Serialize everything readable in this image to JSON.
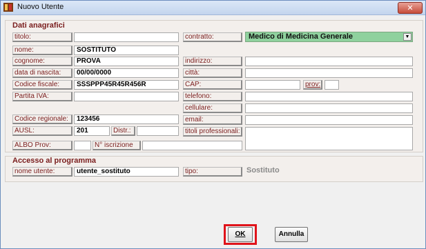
{
  "window": {
    "title": "Nuovo Utente",
    "close_label": "✕"
  },
  "anagrafica": {
    "title": "Dati anagrafici",
    "titolo": {
      "label": "titolo:",
      "value": ""
    },
    "nome": {
      "label": "nome:",
      "value": "SOSTITUTO"
    },
    "cognome": {
      "label": "cognome:",
      "value": "PROVA"
    },
    "data_nascita": {
      "label": "data di nascita:",
      "value": "00/00/0000"
    },
    "codice_fiscale": {
      "label": "Codice fiscale:",
      "value": "SSSPPP45R45R456R"
    },
    "partita_iva": {
      "label": "Partita IVA:",
      "value": ""
    },
    "codice_regionale": {
      "label": "Codice regionale:",
      "value": "123456"
    },
    "ausl": {
      "label": "AUSL:",
      "value": "201"
    },
    "distr": {
      "label": "Distr.:",
      "value": ""
    },
    "albo_prov": {
      "label": "ALBO Prov:",
      "value": ""
    },
    "n_iscrizione": {
      "label": "N° iscrizione",
      "value": ""
    },
    "contratto": {
      "label": "contratto:",
      "value": "Medico di Medicina Generale"
    },
    "indirizzo": {
      "label": "indirizzo:",
      "value": ""
    },
    "citta": {
      "label": "città:",
      "value": ""
    },
    "cap": {
      "label": "CAP:",
      "value": ""
    },
    "prov": {
      "label": "prov:",
      "value": ""
    },
    "telefono": {
      "label": "telefono:",
      "value": ""
    },
    "cellulare": {
      "label": "cellulare:",
      "value": ""
    },
    "email": {
      "label": "email:",
      "value": ""
    },
    "titoli_prof": {
      "label": "titoli professionali:",
      "value": ""
    }
  },
  "accesso": {
    "title": "Accesso al programma",
    "nome_utente": {
      "label": "nome utente:",
      "value": "utente_sostituto"
    },
    "tipo": {
      "label": "tipo:",
      "value": "Sostituto"
    }
  },
  "buttons": {
    "ok": "OK",
    "annulla": "Annulla"
  },
  "colors": {
    "accent_select": "#8fd19e",
    "label_text": "#7a1d1d",
    "highlight": "#e0131a"
  }
}
